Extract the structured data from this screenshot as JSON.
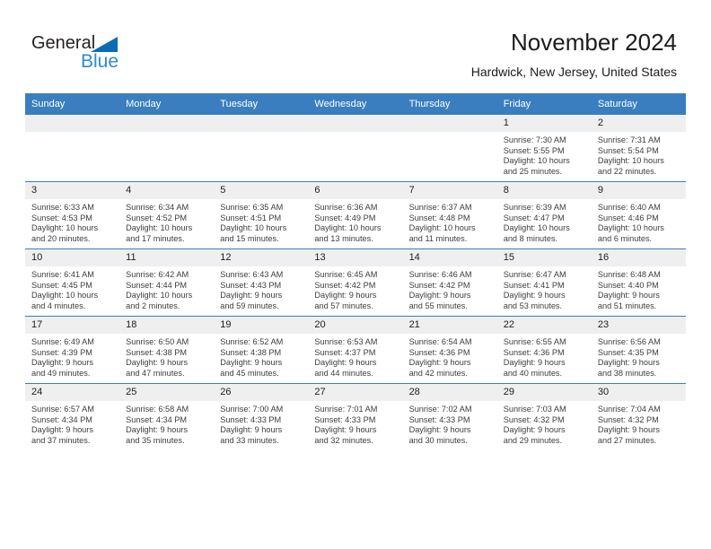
{
  "brand": {
    "name_part1": "General",
    "name_part2": "Blue",
    "triangle_color": "#0b6cb5",
    "blue_text_color": "#2e8ad1"
  },
  "header": {
    "title": "November 2024",
    "subtitle": "Hardwick, New Jersey, United States"
  },
  "colors": {
    "header_blue": "#3a7ebf",
    "daynum_gray": "#efefef",
    "text": "#1c1c1c"
  },
  "calendar": {
    "weekday_headers": [
      "Sunday",
      "Monday",
      "Tuesday",
      "Wednesday",
      "Thursday",
      "Friday",
      "Saturday"
    ],
    "weeks": [
      [
        {
          "day": "",
          "sunrise": "",
          "sunset": "",
          "daylight_line1": "",
          "daylight_line2": "",
          "empty": true
        },
        {
          "day": "",
          "sunrise": "",
          "sunset": "",
          "daylight_line1": "",
          "daylight_line2": "",
          "empty": true
        },
        {
          "day": "",
          "sunrise": "",
          "sunset": "",
          "daylight_line1": "",
          "daylight_line2": "",
          "empty": true
        },
        {
          "day": "",
          "sunrise": "",
          "sunset": "",
          "daylight_line1": "",
          "daylight_line2": "",
          "empty": true
        },
        {
          "day": "",
          "sunrise": "",
          "sunset": "",
          "daylight_line1": "",
          "daylight_line2": "",
          "empty": true
        },
        {
          "day": "1",
          "sunrise": "Sunrise: 7:30 AM",
          "sunset": "Sunset: 5:55 PM",
          "daylight_line1": "Daylight: 10 hours",
          "daylight_line2": "and 25 minutes.",
          "empty": false
        },
        {
          "day": "2",
          "sunrise": "Sunrise: 7:31 AM",
          "sunset": "Sunset: 5:54 PM",
          "daylight_line1": "Daylight: 10 hours",
          "daylight_line2": "and 22 minutes.",
          "empty": false
        }
      ],
      [
        {
          "day": "3",
          "sunrise": "Sunrise: 6:33 AM",
          "sunset": "Sunset: 4:53 PM",
          "daylight_line1": "Daylight: 10 hours",
          "daylight_line2": "and 20 minutes.",
          "empty": false
        },
        {
          "day": "4",
          "sunrise": "Sunrise: 6:34 AM",
          "sunset": "Sunset: 4:52 PM",
          "daylight_line1": "Daylight: 10 hours",
          "daylight_line2": "and 17 minutes.",
          "empty": false
        },
        {
          "day": "5",
          "sunrise": "Sunrise: 6:35 AM",
          "sunset": "Sunset: 4:51 PM",
          "daylight_line1": "Daylight: 10 hours",
          "daylight_line2": "and 15 minutes.",
          "empty": false
        },
        {
          "day": "6",
          "sunrise": "Sunrise: 6:36 AM",
          "sunset": "Sunset: 4:49 PM",
          "daylight_line1": "Daylight: 10 hours",
          "daylight_line2": "and 13 minutes.",
          "empty": false
        },
        {
          "day": "7",
          "sunrise": "Sunrise: 6:37 AM",
          "sunset": "Sunset: 4:48 PM",
          "daylight_line1": "Daylight: 10 hours",
          "daylight_line2": "and 11 minutes.",
          "empty": false
        },
        {
          "day": "8",
          "sunrise": "Sunrise: 6:39 AM",
          "sunset": "Sunset: 4:47 PM",
          "daylight_line1": "Daylight: 10 hours",
          "daylight_line2": "and 8 minutes.",
          "empty": false
        },
        {
          "day": "9",
          "sunrise": "Sunrise: 6:40 AM",
          "sunset": "Sunset: 4:46 PM",
          "daylight_line1": "Daylight: 10 hours",
          "daylight_line2": "and 6 minutes.",
          "empty": false
        }
      ],
      [
        {
          "day": "10",
          "sunrise": "Sunrise: 6:41 AM",
          "sunset": "Sunset: 4:45 PM",
          "daylight_line1": "Daylight: 10 hours",
          "daylight_line2": "and 4 minutes.",
          "empty": false
        },
        {
          "day": "11",
          "sunrise": "Sunrise: 6:42 AM",
          "sunset": "Sunset: 4:44 PM",
          "daylight_line1": "Daylight: 10 hours",
          "daylight_line2": "and 2 minutes.",
          "empty": false
        },
        {
          "day": "12",
          "sunrise": "Sunrise: 6:43 AM",
          "sunset": "Sunset: 4:43 PM",
          "daylight_line1": "Daylight: 9 hours",
          "daylight_line2": "and 59 minutes.",
          "empty": false
        },
        {
          "day": "13",
          "sunrise": "Sunrise: 6:45 AM",
          "sunset": "Sunset: 4:42 PM",
          "daylight_line1": "Daylight: 9 hours",
          "daylight_line2": "and 57 minutes.",
          "empty": false
        },
        {
          "day": "14",
          "sunrise": "Sunrise: 6:46 AM",
          "sunset": "Sunset: 4:42 PM",
          "daylight_line1": "Daylight: 9 hours",
          "daylight_line2": "and 55 minutes.",
          "empty": false
        },
        {
          "day": "15",
          "sunrise": "Sunrise: 6:47 AM",
          "sunset": "Sunset: 4:41 PM",
          "daylight_line1": "Daylight: 9 hours",
          "daylight_line2": "and 53 minutes.",
          "empty": false
        },
        {
          "day": "16",
          "sunrise": "Sunrise: 6:48 AM",
          "sunset": "Sunset: 4:40 PM",
          "daylight_line1": "Daylight: 9 hours",
          "daylight_line2": "and 51 minutes.",
          "empty": false
        }
      ],
      [
        {
          "day": "17",
          "sunrise": "Sunrise: 6:49 AM",
          "sunset": "Sunset: 4:39 PM",
          "daylight_line1": "Daylight: 9 hours",
          "daylight_line2": "and 49 minutes.",
          "empty": false
        },
        {
          "day": "18",
          "sunrise": "Sunrise: 6:50 AM",
          "sunset": "Sunset: 4:38 PM",
          "daylight_line1": "Daylight: 9 hours",
          "daylight_line2": "and 47 minutes.",
          "empty": false
        },
        {
          "day": "19",
          "sunrise": "Sunrise: 6:52 AM",
          "sunset": "Sunset: 4:38 PM",
          "daylight_line1": "Daylight: 9 hours",
          "daylight_line2": "and 45 minutes.",
          "empty": false
        },
        {
          "day": "20",
          "sunrise": "Sunrise: 6:53 AM",
          "sunset": "Sunset: 4:37 PM",
          "daylight_line1": "Daylight: 9 hours",
          "daylight_line2": "and 44 minutes.",
          "empty": false
        },
        {
          "day": "21",
          "sunrise": "Sunrise: 6:54 AM",
          "sunset": "Sunset: 4:36 PM",
          "daylight_line1": "Daylight: 9 hours",
          "daylight_line2": "and 42 minutes.",
          "empty": false
        },
        {
          "day": "22",
          "sunrise": "Sunrise: 6:55 AM",
          "sunset": "Sunset: 4:36 PM",
          "daylight_line1": "Daylight: 9 hours",
          "daylight_line2": "and 40 minutes.",
          "empty": false
        },
        {
          "day": "23",
          "sunrise": "Sunrise: 6:56 AM",
          "sunset": "Sunset: 4:35 PM",
          "daylight_line1": "Daylight: 9 hours",
          "daylight_line2": "and 38 minutes.",
          "empty": false
        }
      ],
      [
        {
          "day": "24",
          "sunrise": "Sunrise: 6:57 AM",
          "sunset": "Sunset: 4:34 PM",
          "daylight_line1": "Daylight: 9 hours",
          "daylight_line2": "and 37 minutes.",
          "empty": false
        },
        {
          "day": "25",
          "sunrise": "Sunrise: 6:58 AM",
          "sunset": "Sunset: 4:34 PM",
          "daylight_line1": "Daylight: 9 hours",
          "daylight_line2": "and 35 minutes.",
          "empty": false
        },
        {
          "day": "26",
          "sunrise": "Sunrise: 7:00 AM",
          "sunset": "Sunset: 4:33 PM",
          "daylight_line1": "Daylight: 9 hours",
          "daylight_line2": "and 33 minutes.",
          "empty": false
        },
        {
          "day": "27",
          "sunrise": "Sunrise: 7:01 AM",
          "sunset": "Sunset: 4:33 PM",
          "daylight_line1": "Daylight: 9 hours",
          "daylight_line2": "and 32 minutes.",
          "empty": false
        },
        {
          "day": "28",
          "sunrise": "Sunrise: 7:02 AM",
          "sunset": "Sunset: 4:33 PM",
          "daylight_line1": "Daylight: 9 hours",
          "daylight_line2": "and 30 minutes.",
          "empty": false
        },
        {
          "day": "29",
          "sunrise": "Sunrise: 7:03 AM",
          "sunset": "Sunset: 4:32 PM",
          "daylight_line1": "Daylight: 9 hours",
          "daylight_line2": "and 29 minutes.",
          "empty": false
        },
        {
          "day": "30",
          "sunrise": "Sunrise: 7:04 AM",
          "sunset": "Sunset: 4:32 PM",
          "daylight_line1": "Daylight: 9 hours",
          "daylight_line2": "and 27 minutes.",
          "empty": false
        }
      ]
    ]
  }
}
